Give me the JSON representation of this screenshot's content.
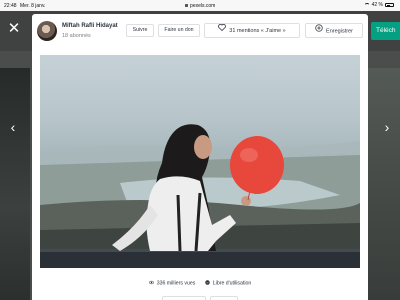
{
  "status_bar": {
    "time": "22:48",
    "date": "Mer. 8 janv.",
    "url": "pexels.com",
    "battery": "42 %"
  },
  "background": {
    "download_label": "Téléch"
  },
  "modal": {
    "author": {
      "name": "Miftah Rafli Hidayat",
      "followers": "18 abonnés"
    },
    "buttons": {
      "follow": "Suivre",
      "donate": "Faire un don",
      "like": "31 mentions « J'aime »",
      "save": "Enregistrer"
    },
    "meta": {
      "views": "336 milliers vues",
      "license": "Libre d'utilisation"
    }
  },
  "icons": [
    "close-icon",
    "chevron-left-icon",
    "chevron-right-icon",
    "heart-icon",
    "plus-circle-icon",
    "eye-icon",
    "check-circle-icon",
    "lock-icon",
    "wifi-icon",
    "battery-icon"
  ],
  "colors": {
    "download_green": "#05a081",
    "balloon": "#e8473b",
    "backdrop": "#4a4d4b"
  }
}
